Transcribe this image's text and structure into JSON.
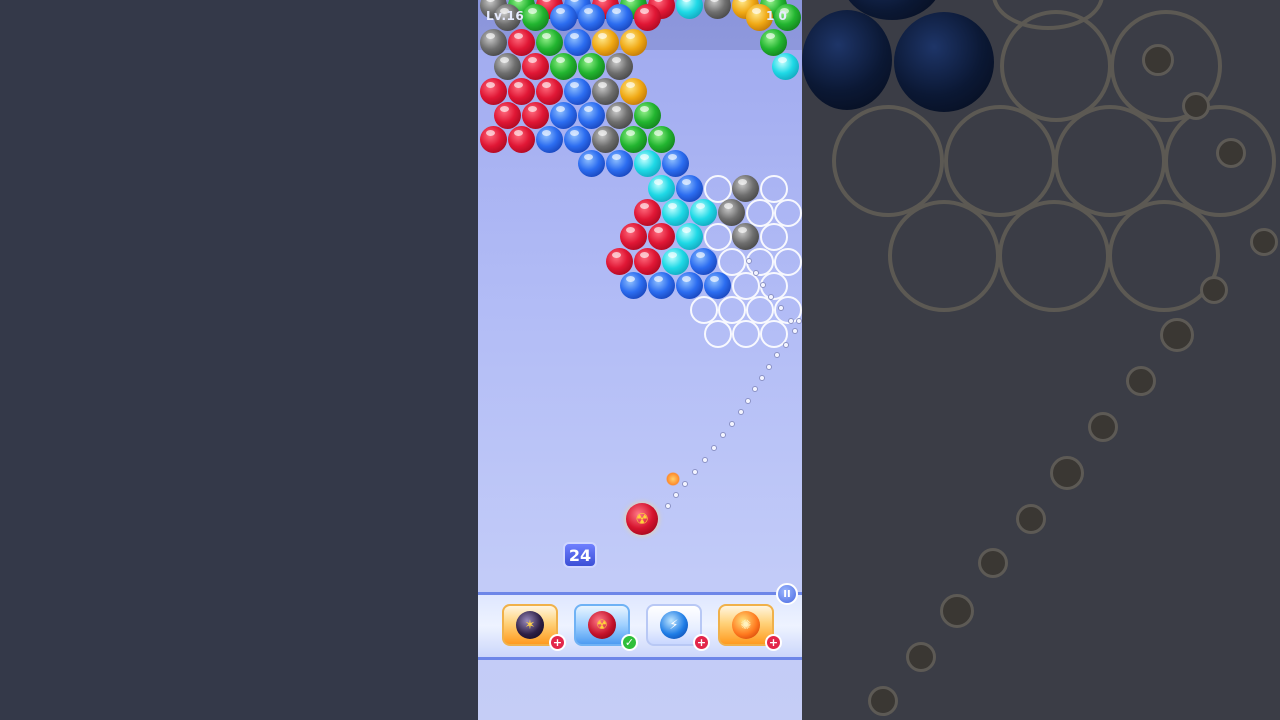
{
  "game": {
    "level_label": "Lv.16",
    "score_right": "1 0",
    "moves_remaining": "24",
    "current_bubble": "bomb-nuke"
  },
  "boosters": [
    {
      "name": "bomb",
      "icon": "bomb-icon",
      "badge": "+",
      "state": "add"
    },
    {
      "name": "nuke",
      "icon": "nuke-bomb-icon",
      "badge": "✓",
      "state": "selected"
    },
    {
      "name": "lightning",
      "icon": "lightning-ball-icon",
      "badge": "+",
      "state": "add"
    },
    {
      "name": "fireball",
      "icon": "fireball-icon",
      "badge": "+",
      "state": "add"
    }
  ],
  "pause_label": "II",
  "colors": {
    "red": "#e01735",
    "blue": "#2c6df0",
    "green": "#22b530",
    "gray": "#6f6f6f",
    "cyan": "#1fd9e6",
    "gold": "#f0a915"
  }
}
